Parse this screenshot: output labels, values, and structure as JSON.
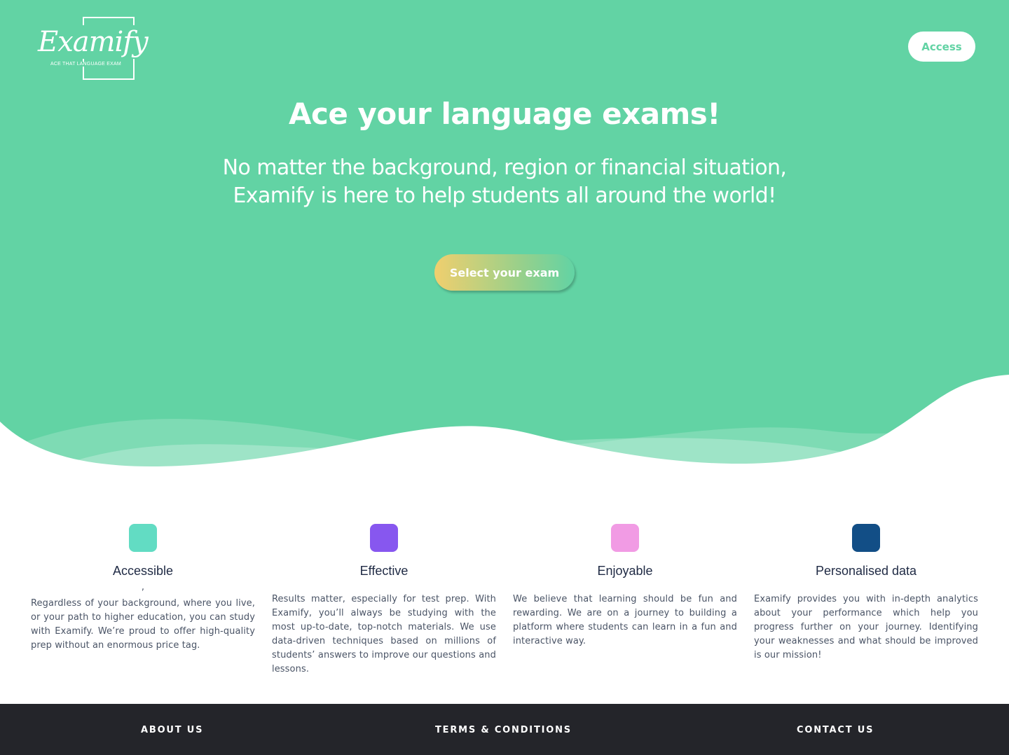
{
  "brand": {
    "name": "Examify",
    "tagline": "ACE THAT LANGUAGE EXAM"
  },
  "header": {
    "access_label": "Access"
  },
  "hero": {
    "headline": "Ace your language exams!",
    "subline_1": "No matter the background, region or financial situation,",
    "subline_2": "Examify is here to help students all around the world!",
    "cta_label": "Select your exam"
  },
  "features": [
    {
      "title": "Accessible",
      "color": "#62dcc3",
      "stray_mark": ",",
      "text": "Regardless of your background, where you live, or your path to higher education, you can study with Examify. We’re proud to offer high-quality prep without an enormous price tag."
    },
    {
      "title": "Effective",
      "color": "#8757ef",
      "text": "Results matter, especially for test prep. With Examify, you’ll always be studying with the most up-to-date, top-notch materials. We use data-driven techniques based on millions of students’ answers to improve our questions and lessons."
    },
    {
      "title": "Enjoyable",
      "color": "#f19be4",
      "text": "We believe that learning should be fun and rewarding. We are on a journey to building a platform where students can learn in a fun and interactive way."
    },
    {
      "title": "Personalised data",
      "color": "#124e86",
      "text": "Examify provides you with in-depth analytics about your performance which help you progress further on your journey. Identifying your weaknesses and what should be improved is our mission!"
    }
  ],
  "footer": {
    "about": "ABOUT US",
    "terms": "TERMS & CONDITIONS",
    "contact": "CONTACT US"
  },
  "colors": {
    "hero_green": "#62d3a4",
    "footer_dark": "#24252a",
    "cta_gradient_start": "#f0cf6e"
  }
}
